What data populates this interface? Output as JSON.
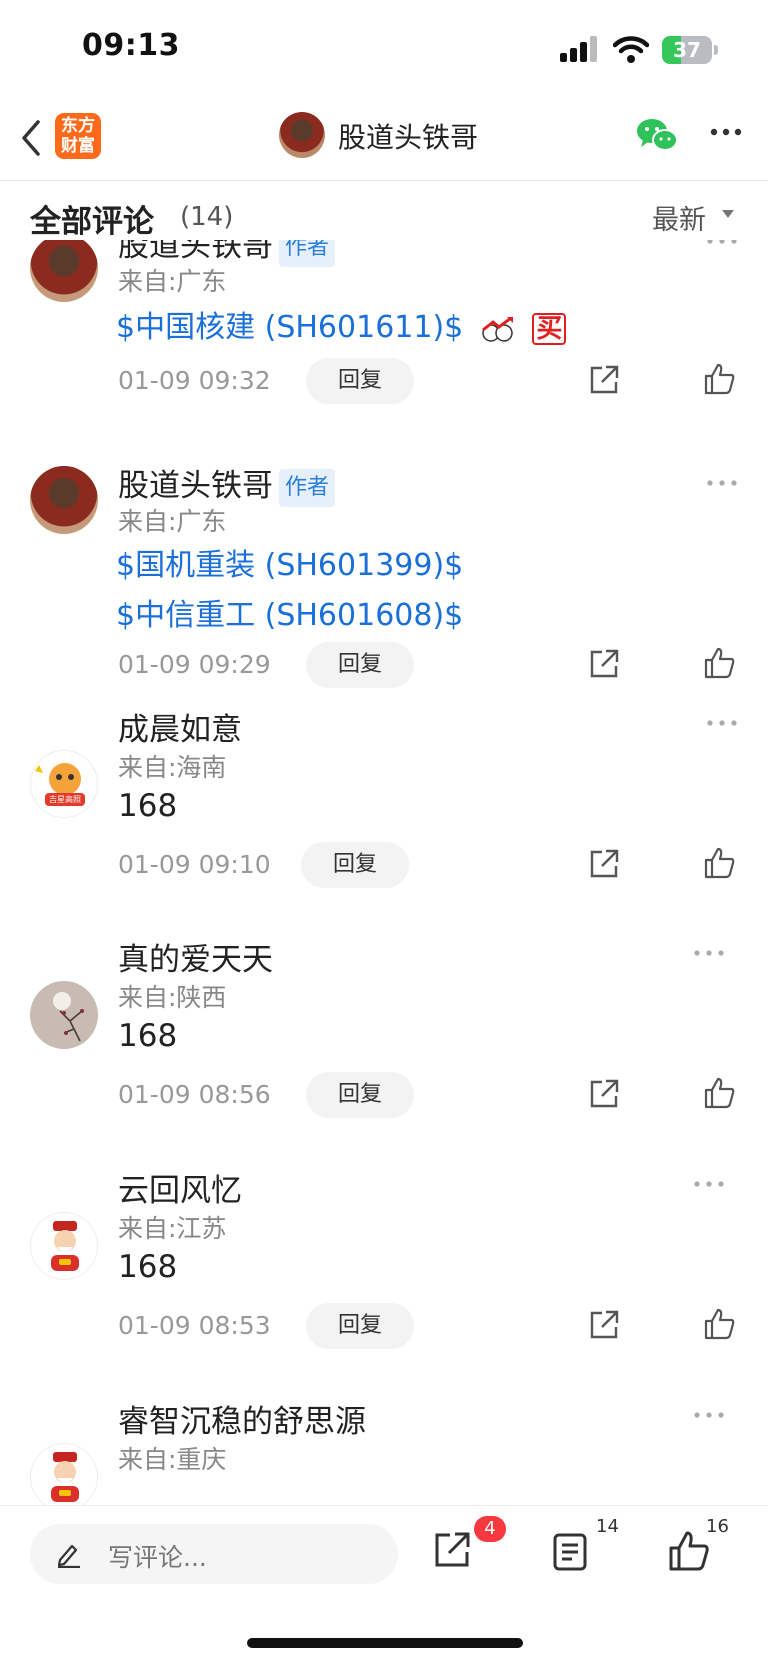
{
  "status_bar": {
    "time": "09:13",
    "battery": "37",
    "battery_level": 0.37
  },
  "nav": {
    "logo_line1": "东方",
    "logo_line2": "财富",
    "title": "股道头铁哥"
  },
  "header": {
    "title": "全部评论",
    "count": "(14)",
    "sort_label": "最新"
  },
  "comments": [
    {
      "name": "股道头铁哥",
      "badge": "作者",
      "location": "来自:广东",
      "links": [
        "$中国核建 (SH601611)$"
      ],
      "emoji": "买",
      "time": "01-09 09:32",
      "reply": "回复"
    },
    {
      "name": "股道头铁哥",
      "badge": "作者",
      "location": "来自:广东",
      "links": [
        "$国机重装 (SH601399)$",
        "$中信重工 (SH601608)$"
      ],
      "time": "01-09 09:29",
      "reply": "回复"
    },
    {
      "name": "成晨如意",
      "avatar_text": "吉星高照",
      "location": "来自:海南",
      "text": "168",
      "time": "01-09 09:10",
      "reply": "回复"
    },
    {
      "name": "真的爱天天",
      "location": "来自:陕西",
      "text": "168",
      "time": "01-09 08:56",
      "reply": "回复"
    },
    {
      "name": "云回风忆",
      "location": "来自:江苏",
      "text": "168",
      "time": "01-09 08:53",
      "reply": "回复"
    },
    {
      "name": "睿智沉稳的舒思源",
      "location": "来自:重庆"
    }
  ],
  "bottom_bar": {
    "input_placeholder": "写评论...",
    "share_badge": "4",
    "list_count": "14",
    "like_count": "16"
  },
  "colors": {
    "link": "#1a6fd8",
    "brand": "#ff6a1a",
    "badge_red": "#f5393f",
    "wechat": "#2fc15a"
  }
}
